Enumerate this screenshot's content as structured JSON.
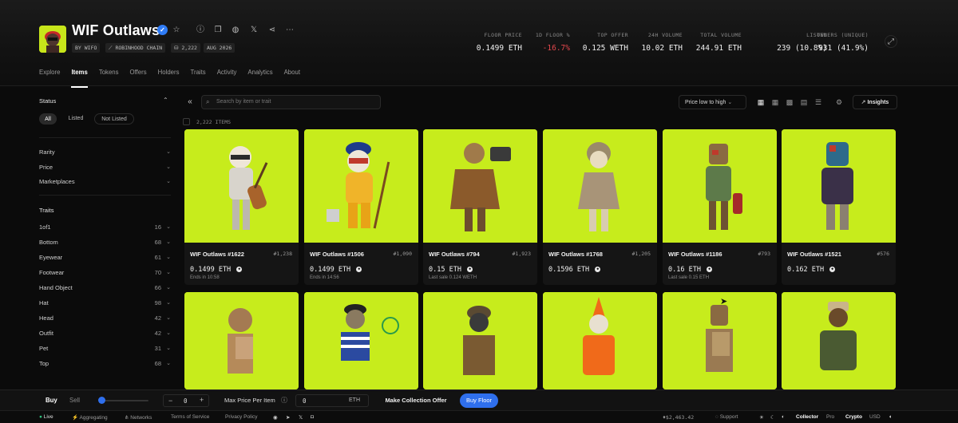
{
  "collection": {
    "name": "WIF Outlaws",
    "chips": [
      "BY WIFO",
      "ROBINHOOD CHAIN",
      "2,222",
      "AUG 2026"
    ]
  },
  "stats": [
    {
      "label": "FLOOR PRICE",
      "value": "0.1499 ETH"
    },
    {
      "label": "1D FLOOR %",
      "value": "-16.7%"
    },
    {
      "label": "TOP OFFER",
      "value": "0.125 WETH"
    },
    {
      "label": "24H VOLUME",
      "value": "10.02 ETH"
    },
    {
      "label": "TOTAL VOLUME",
      "value": "244.91 ETH"
    },
    {
      "label": "LISTED",
      "value": "239 (10.8%)"
    },
    {
      "label": "OWNERS (UNIQUE)",
      "value": "931 (41.9%)"
    }
  ],
  "colors": {
    "negative": "#e5484d",
    "accent": "#2f6fed",
    "art_bg": "#c7ec1c",
    "live": "#2ec27e"
  },
  "tabs": [
    "Explore",
    "Items",
    "Tokens",
    "Offers",
    "Holders",
    "Traits",
    "Activity",
    "Analytics",
    "About"
  ],
  "sidebar": {
    "status_label": "Status",
    "status_options": [
      "All",
      "Listed",
      "Not Listed"
    ],
    "filters": [
      "Rarity",
      "Price",
      "Marketplaces"
    ],
    "traits_label": "Traits",
    "traits": [
      {
        "name": "1of1",
        "count": "16"
      },
      {
        "name": "Bottom",
        "count": "68"
      },
      {
        "name": "Eyewear",
        "count": "61"
      },
      {
        "name": "Footwear",
        "count": "70"
      },
      {
        "name": "Hand Object",
        "count": "66"
      },
      {
        "name": "Hat",
        "count": "98"
      },
      {
        "name": "Head",
        "count": "42"
      },
      {
        "name": "Outfit",
        "count": "42"
      },
      {
        "name": "Pet",
        "count": "31"
      },
      {
        "name": "Top",
        "count": "68"
      }
    ]
  },
  "toolbar": {
    "search_placeholder": "Search by item or trait",
    "item_count": "2,222 ITEMS",
    "sort": "Price low to high",
    "insights": "Insights"
  },
  "items": [
    {
      "name": "WIF Outlaws #1622",
      "rank": "#1,238",
      "price": "0.1499 ETH",
      "sub": "Ends in 10:58"
    },
    {
      "name": "WIF Outlaws #1506",
      "rank": "#1,090",
      "price": "0.1499 ETH",
      "sub": "Ends in 14:56"
    },
    {
      "name": "WIF Outlaws #794",
      "rank": "#1,923",
      "price": "0.15 ETH",
      "sub": "Last sale 0.124 WETH"
    },
    {
      "name": "WIF Outlaws #1768",
      "rank": "#1,205",
      "price": "0.1596 ETH",
      "sub": ""
    },
    {
      "name": "WIF Outlaws #1186",
      "rank": "#793",
      "price": "0.16 ETH",
      "sub": "Last sale 0.15 ETH"
    },
    {
      "name": "WIF Outlaws #1521",
      "rank": "#576",
      "price": "0.162 ETH",
      "sub": ""
    },
    {
      "name": "",
      "rank": "",
      "price": "",
      "sub": ""
    },
    {
      "name": "",
      "rank": "",
      "price": "",
      "sub": ""
    },
    {
      "name": "",
      "rank": "",
      "price": "",
      "sub": ""
    },
    {
      "name": "",
      "rank": "",
      "price": "",
      "sub": ""
    },
    {
      "name": "",
      "rank": "",
      "price": "",
      "sub": ""
    },
    {
      "name": "",
      "rank": "",
      "price": "",
      "sub": ""
    }
  ],
  "buybar": {
    "buy": "Buy",
    "sell": "Sell",
    "qty": "0",
    "max_price_label": "Max Price Per Item",
    "max_price_value": "0",
    "currency": "ETH",
    "offer_btn": "Make Collection Offer",
    "floor_btn": "Buy Floor"
  },
  "statusbar": {
    "live": "Live",
    "aggregating": "Aggregating",
    "networks": "Networks",
    "terms": "Terms of Service",
    "privacy": "Privacy Policy",
    "eth_price": "$2,463.42",
    "support": "Support",
    "mode1": "Collector",
    "mode2": "Pro",
    "cur1": "Crypto",
    "cur2": "USD"
  }
}
